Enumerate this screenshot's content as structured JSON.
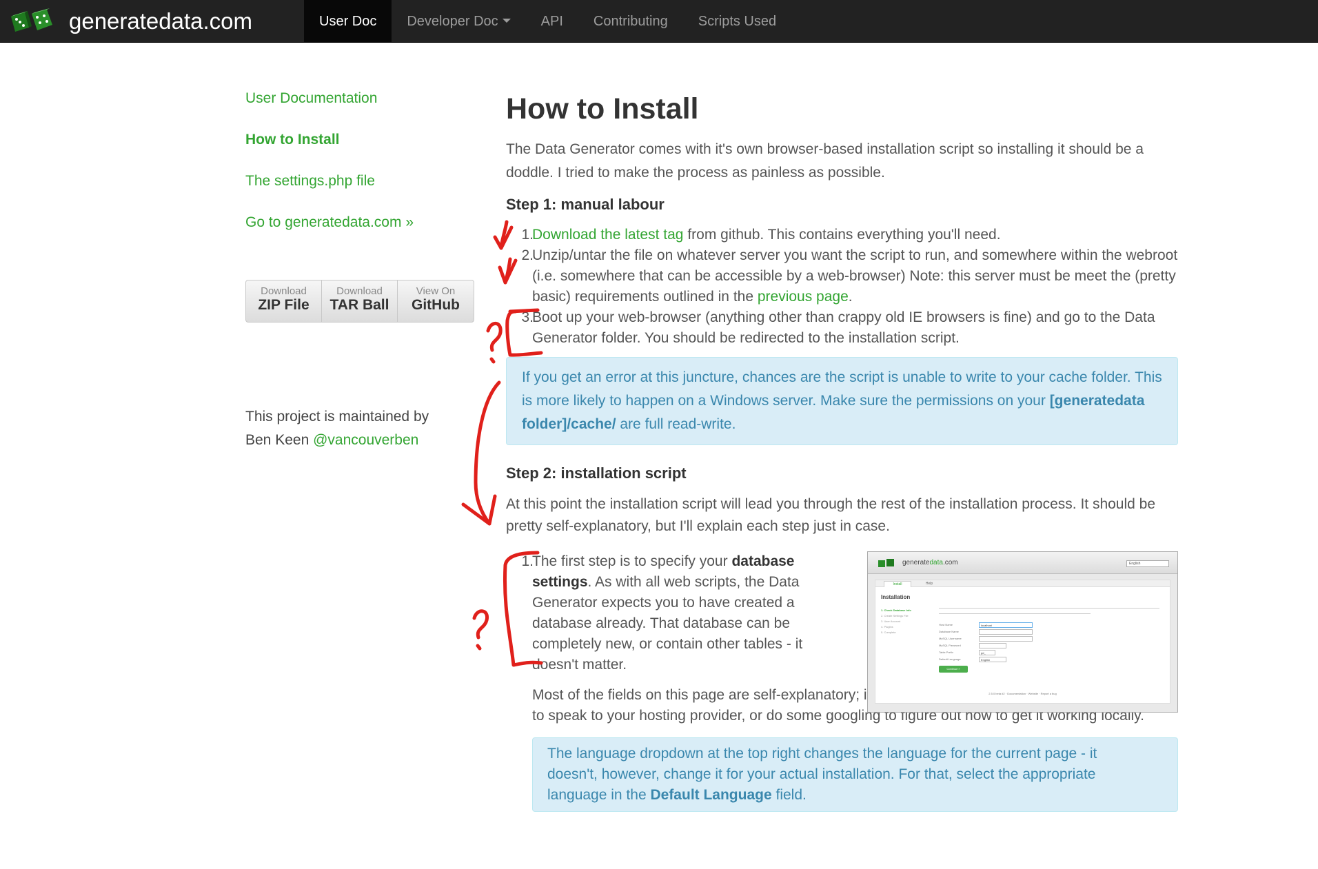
{
  "brand": {
    "name": "generatedata.com"
  },
  "nav": {
    "items": [
      {
        "label": "User Doc",
        "active": true
      },
      {
        "label": "Developer Doc",
        "dropdown": true
      },
      {
        "label": "API"
      },
      {
        "label": "Contributing"
      },
      {
        "label": "Scripts Used"
      }
    ]
  },
  "sidebar": {
    "links": [
      {
        "label": "User Documentation"
      },
      {
        "label": "How to Install",
        "active": true
      },
      {
        "label": "The settings.php file"
      },
      {
        "label": "Go to generatedata.com »"
      }
    ],
    "downloads": [
      {
        "small": "Download",
        "big": "ZIP File"
      },
      {
        "small": "Download",
        "big": "TAR Ball"
      },
      {
        "small": "View On",
        "big": "GitHub"
      }
    ],
    "maintained_prefix": "This project is maintained by",
    "maintained_name": "Ben Keen",
    "maintained_handle": "@vancouverben"
  },
  "main": {
    "title": "How to Install",
    "intro": "The Data Generator comes with it's own browser-based installation script so installing it should be a doddle. I tried to make the process as painless as possible.",
    "step1_heading": "Step 1: manual labour",
    "step1_items": [
      {
        "num": "1.",
        "link": "Download the latest tag",
        "text": " from github. This contains everything you'll need."
      },
      {
        "num": "2.",
        "text": "Unzip/untar the file on whatever server you want the script to run, and somewhere within the webroot (i.e. somewhere that can be accessible by a web-browser) Note: this server must be meet the (pretty basic) requirements outlined in the ",
        "link": "previous page",
        "after": "."
      },
      {
        "num": "3.",
        "text": "Boot up your web-browser (anything other than crappy old IE browsers is fine) and go to the Data Generator folder. You should be redirected to the installation script."
      }
    ],
    "alert1": {
      "text1": "If you get an error at this juncture, chances are the script is unable to write to your cache folder. This is more likely to happen on a Windows server. Make sure the permissions on your ",
      "bold": "[generatedata folder]/cache/",
      "text2": " are full read-write."
    },
    "step2_heading": "Step 2: installation script",
    "step2_intro": "At this point the installation script will lead you through the rest of the installation process. It should be pretty self-explanatory, but I'll explain each step just in case.",
    "step2_item": {
      "num": "1.",
      "text1": "The first step is to specify your ",
      "bold": "database settings",
      "text2": ". As with all web scripts, the Data Generator expects you to have created a database already. That database can be completely new, or contain other tables - it doesn't matter."
    },
    "step2_para": "Most of the fields on this page are self-explanatory; if you're not sure about any of them, you'll need to speak to your hosting provider, or do some googling to figure out how to get it working locally.",
    "alert2": {
      "text1": "The language dropdown at the top right changes the language for the current page - it doesn't, however, change it for your actual installation. For that, select the appropriate language in the ",
      "bold": "Default Language",
      "text2": " field."
    }
  },
  "screenshot": {
    "brand_prefix": "generate",
    "brand_accent": "data",
    "brand_suffix": ".com",
    "language": "English",
    "tabs": [
      "Install",
      "Help"
    ],
    "heading": "Installation",
    "steps": [
      "1. Check Database Info",
      "2. Create Settings File",
      "3. User Account",
      "4. Plugins",
      "5. Complete"
    ],
    "fields": [
      {
        "label": "Host Name",
        "value": "localhost"
      },
      {
        "label": "Database Name",
        "value": ""
      },
      {
        "label": "MySQL Username",
        "value": ""
      },
      {
        "label": "MySQL Password",
        "value": ""
      },
      {
        "label": "Table Prefix",
        "value": "gd_"
      },
      {
        "label": "Default Language",
        "value": "English"
      }
    ],
    "button": "Continue »",
    "footer": "2.5.0 beta #2  ·  Documentation  ·  Website  ·  Report a bug"
  },
  "colors": {
    "link_green": "#33a532",
    "nav_bg": "#222222",
    "alert_bg": "#d9edf7",
    "alert_text": "#3a87ad",
    "annotation_red": "#e0201b"
  }
}
